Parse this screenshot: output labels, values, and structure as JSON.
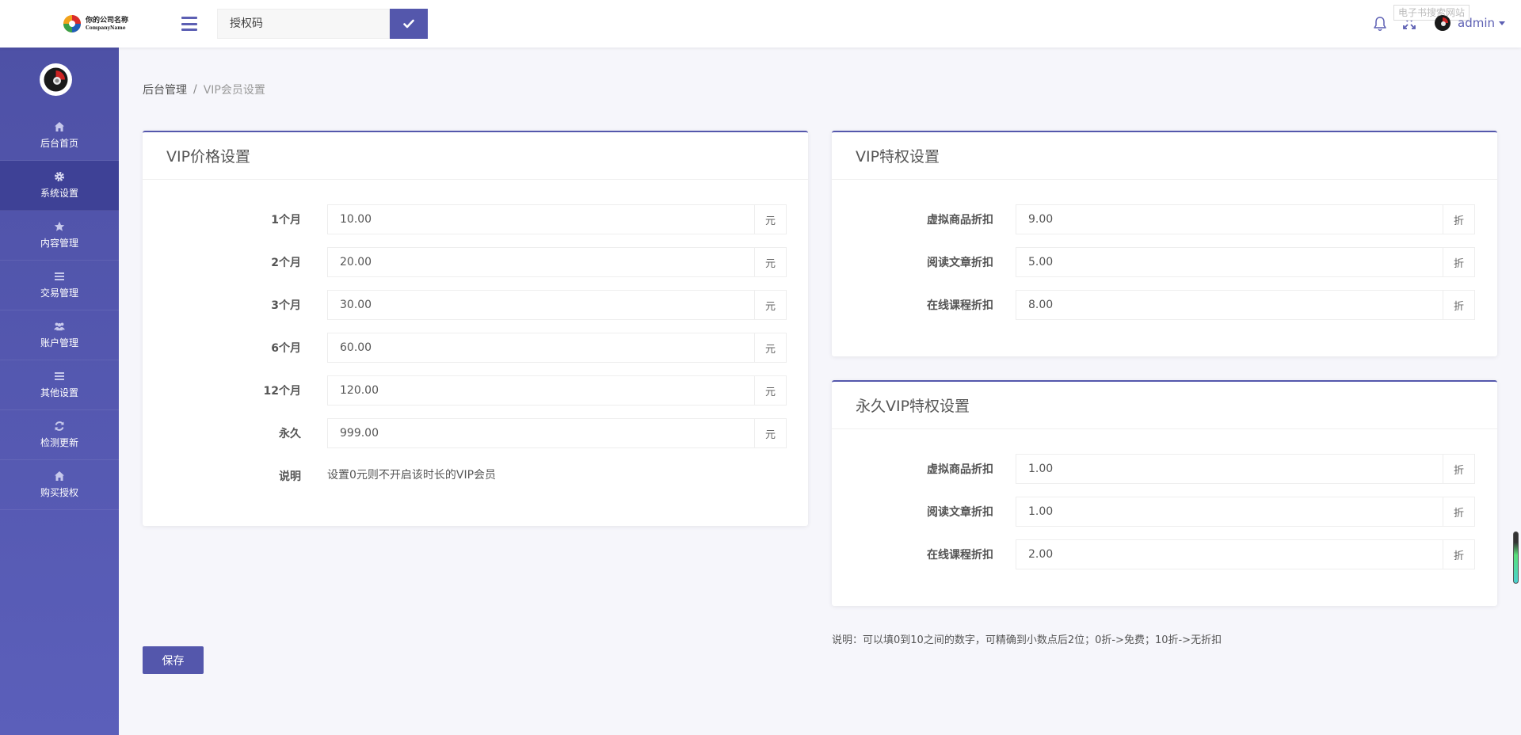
{
  "header": {
    "logo": {
      "name": "你的公司名称",
      "sub": "CompanyName"
    },
    "auth_placeholder": "授权码",
    "note": "电子书搜索网站",
    "user_name": "admin"
  },
  "sidebar": {
    "items": [
      {
        "label": "后台首页",
        "icon": "home-icon"
      },
      {
        "label": "系统设置",
        "icon": "gear-icon"
      },
      {
        "label": "内容管理",
        "icon": "star-icon"
      },
      {
        "label": "交易管理",
        "icon": "list-icon"
      },
      {
        "label": "账户管理",
        "icon": "users-icon"
      },
      {
        "label": "其他设置",
        "icon": "list-icon"
      },
      {
        "label": "检测更新",
        "icon": "refresh-icon"
      },
      {
        "label": "购买授权",
        "icon": "home-icon"
      }
    ],
    "active_index": 1
  },
  "breadcrumb": {
    "root": "后台管理",
    "sep": "/",
    "current": "VIP会员设置"
  },
  "vip_price": {
    "title": "VIP价格设置",
    "unit": "元",
    "rows": [
      {
        "label": "1个月",
        "value": "10.00"
      },
      {
        "label": "2个月",
        "value": "20.00"
      },
      {
        "label": "3个月",
        "value": "30.00"
      },
      {
        "label": "6个月",
        "value": "60.00"
      },
      {
        "label": "12个月",
        "value": "120.00"
      },
      {
        "label": "永久",
        "value": "999.00"
      }
    ],
    "note_label": "说明",
    "note_text": "设置0元则不开启该时长的VIP会员"
  },
  "vip_privilege": {
    "title": "VIP特权设置",
    "unit": "折",
    "rows": [
      {
        "label": "虚拟商品折扣",
        "value": "9.00"
      },
      {
        "label": "阅读文章折扣",
        "value": "5.00"
      },
      {
        "label": "在线课程折扣",
        "value": "8.00"
      }
    ]
  },
  "perm_privilege": {
    "title": "永久VIP特权设置",
    "unit": "折",
    "rows": [
      {
        "label": "虚拟商品折扣",
        "value": "1.00"
      },
      {
        "label": "阅读文章折扣",
        "value": "1.00"
      },
      {
        "label": "在线课程折扣",
        "value": "2.00"
      }
    ]
  },
  "bottom_note": "说明：可以填0到10之间的数字，可精确到小数点后2位；0折->免费；10折->无折扣",
  "save_label": "保存",
  "colors": {
    "primary": "#5457ac",
    "sidebar_active": "#3e4196",
    "background": "#f6f6fb"
  }
}
